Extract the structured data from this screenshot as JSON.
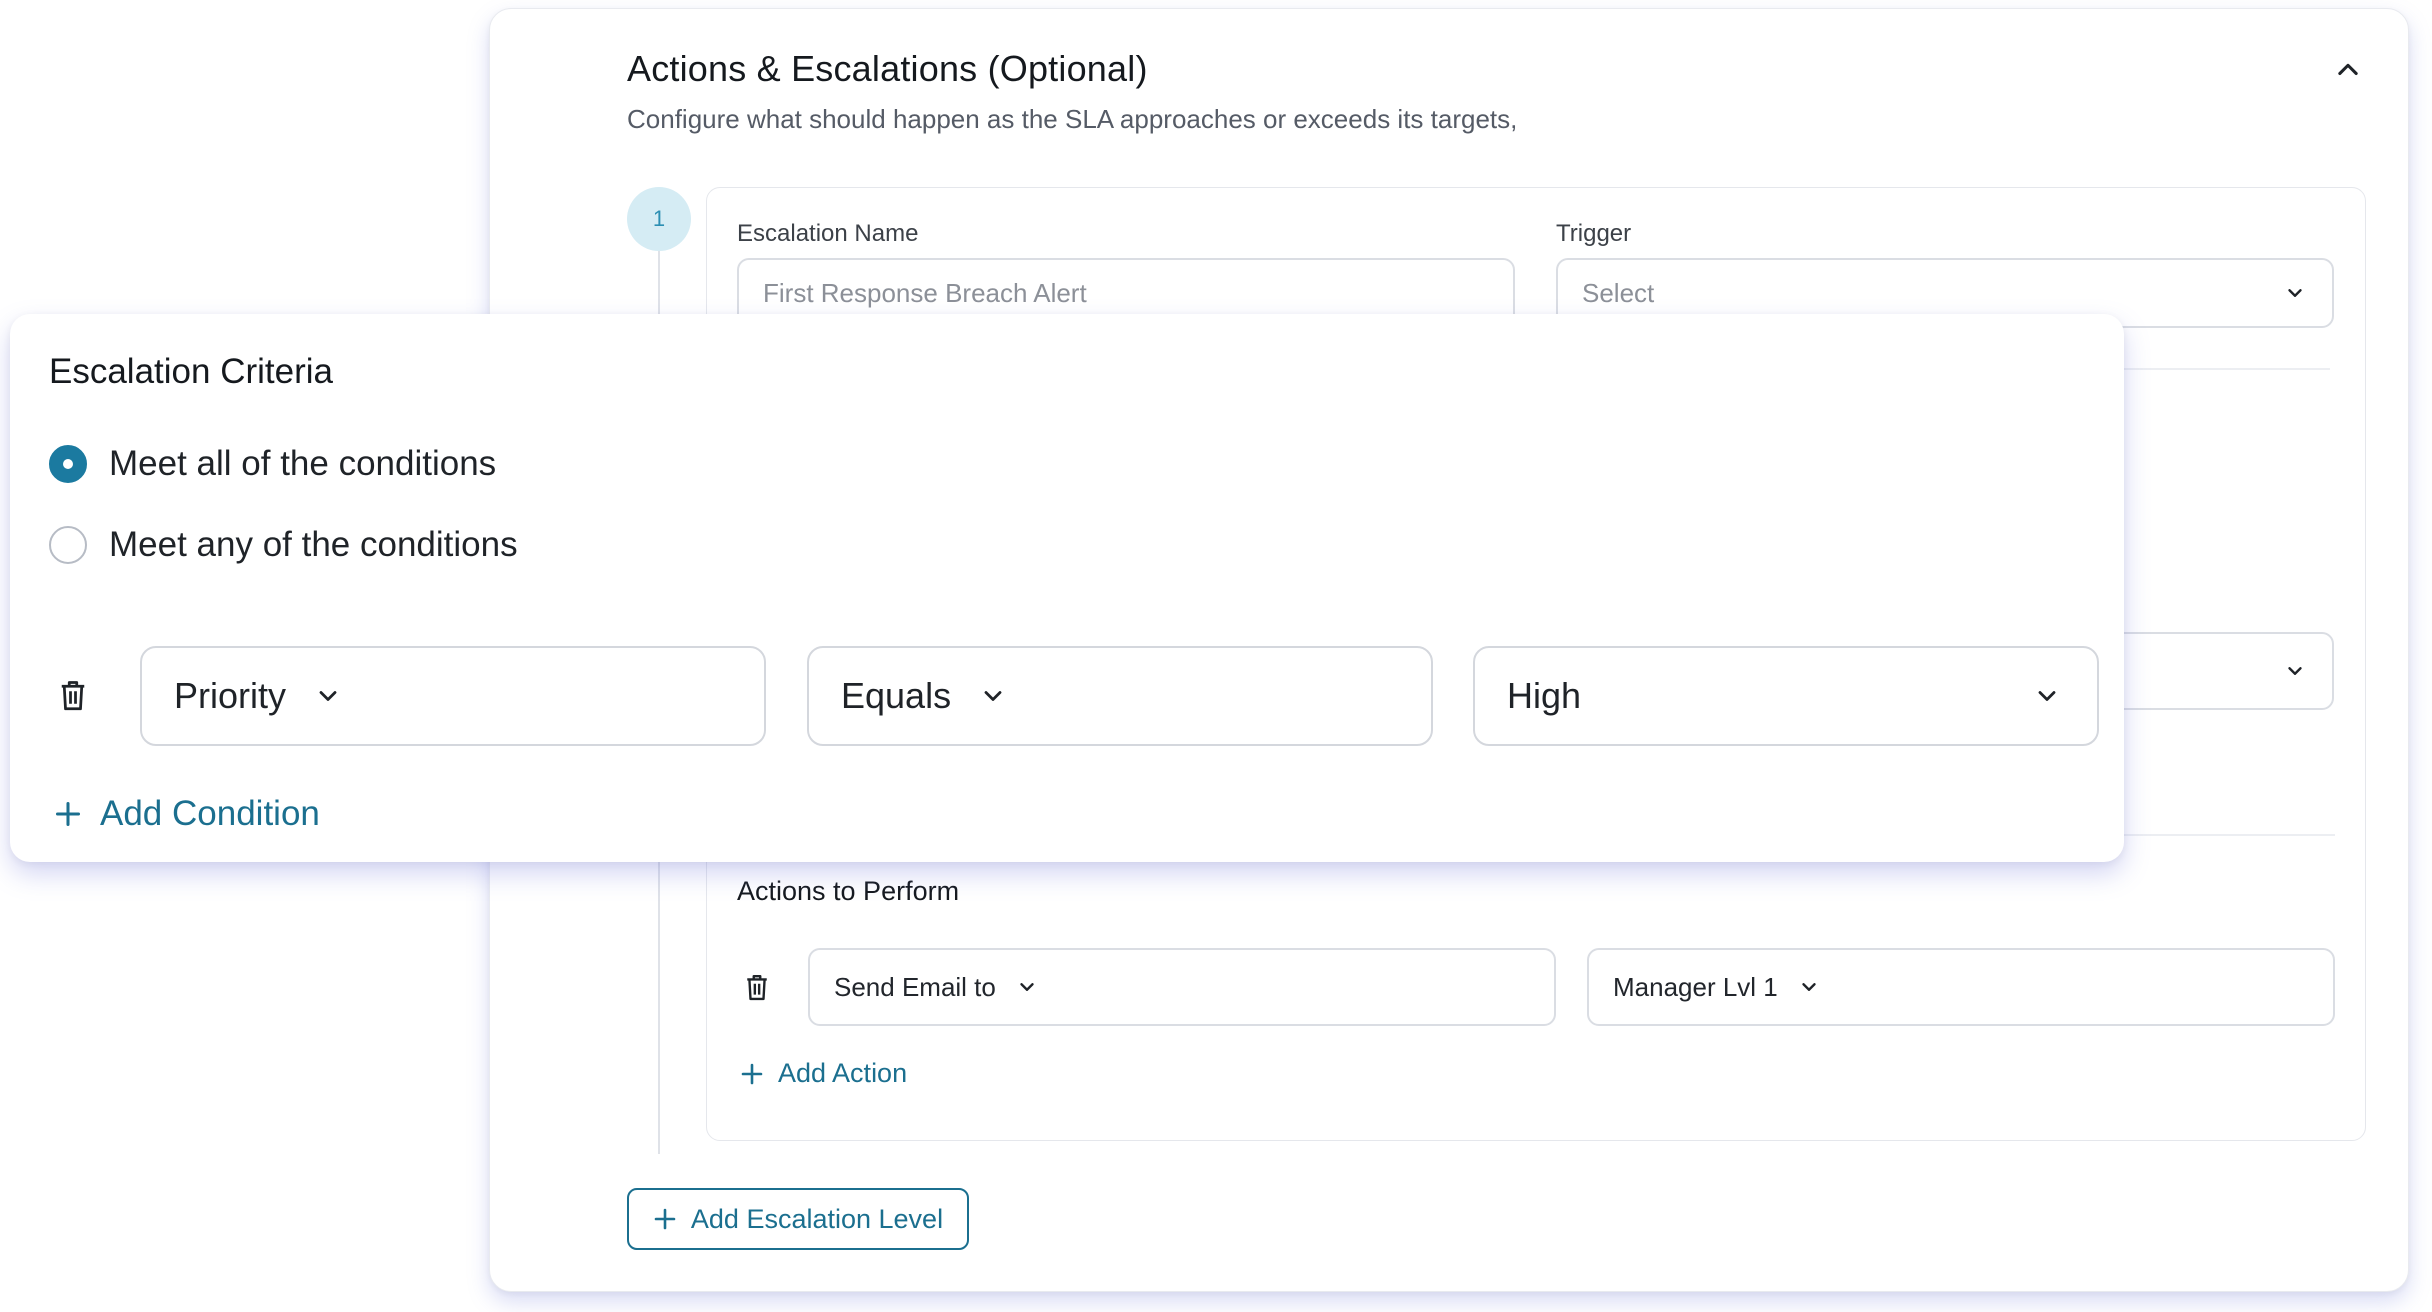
{
  "panel": {
    "title": "Actions & Escalations (Optional)",
    "subtitle": "Configure what should happen as the SLA approaches or exceeds its targets,",
    "collapse_icon": "chevron-up-icon"
  },
  "level": {
    "step_number": "1",
    "escalation_name": {
      "label": "Escalation Name",
      "placeholder": "First Response Breach Alert"
    },
    "trigger": {
      "label": "Trigger",
      "value": "Select"
    },
    "actions": {
      "heading": "Actions to Perform",
      "rows": [
        {
          "action": "Send Email to",
          "target": "Manager Lvl 1"
        }
      ],
      "add_label": "Add Action"
    }
  },
  "add_level_label": "Add Escalation Level",
  "criteria": {
    "title": "Escalation Criteria",
    "options": [
      {
        "label": "Meet all of the conditions",
        "selected": true
      },
      {
        "label": "Meet any of the conditions",
        "selected": false
      }
    ],
    "conditions": [
      {
        "field": "Priority",
        "operator": "Equals",
        "value": "High"
      }
    ],
    "add_label": "Add Condition"
  },
  "colors": {
    "accent": "#1b6f8f",
    "radio_selected": "#1b7aa0",
    "step_badge_bg": "#d5ecf4",
    "shadow": "#7880dc"
  }
}
